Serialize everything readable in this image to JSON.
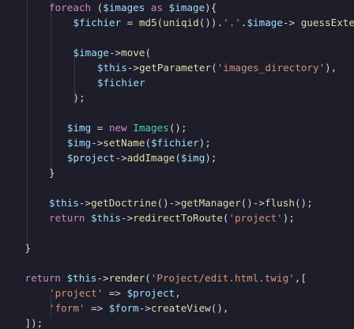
{
  "editor": {
    "language": "php",
    "colors": {
      "background": "#1e1e2a",
      "keyword": "#c586c0",
      "variable": "#9cdcfe",
      "function": "#dcdcaa",
      "string": "#ce9178",
      "class": "#4ec9b0",
      "plain": "#d4d4d4"
    },
    "lines": [
      {
        "indent": 2,
        "tokens": [
          [
            "foreach",
            "kw"
          ],
          [
            " (",
            "pn"
          ],
          [
            "$images",
            "var"
          ],
          [
            " as ",
            "kw"
          ],
          [
            "$image",
            "var"
          ],
          [
            "){",
            "pn"
          ]
        ]
      },
      {
        "indent": 3,
        "tokens": [
          [
            "$fichier",
            "var"
          ],
          [
            " = ",
            "op"
          ],
          [
            "md5",
            "fn"
          ],
          [
            "(",
            "pn"
          ],
          [
            "uniqid",
            "fn"
          ],
          [
            "()).",
            "pn"
          ],
          [
            "'.'",
            "str"
          ],
          [
            ".",
            "op"
          ],
          [
            "$image",
            "var"
          ],
          [
            "-> ",
            "op"
          ],
          [
            "guessExtension",
            "fn"
          ],
          [
            "();",
            "pn"
          ]
        ]
      },
      {
        "indent": 0,
        "tokens": []
      },
      {
        "indent": 3,
        "tokens": [
          [
            "$image",
            "var"
          ],
          [
            "->",
            "op"
          ],
          [
            "move",
            "fn"
          ],
          [
            "(",
            "pn"
          ]
        ]
      },
      {
        "indent": 4,
        "tokens": [
          [
            "$this",
            "var"
          ],
          [
            "->",
            "op"
          ],
          [
            "getParameter",
            "fn"
          ],
          [
            "(",
            "pn"
          ],
          [
            "'images_directory'",
            "str"
          ],
          [
            "),",
            "pn"
          ]
        ]
      },
      {
        "indent": 4,
        "tokens": [
          [
            "$fichier",
            "var"
          ]
        ]
      },
      {
        "indent": 3,
        "tokens": [
          [
            ");",
            "pn"
          ]
        ]
      },
      {
        "indent": 0,
        "tokens": []
      },
      {
        "indent": 2.75,
        "tokens": [
          [
            "$img",
            "var"
          ],
          [
            " = ",
            "op"
          ],
          [
            "new ",
            "kw"
          ],
          [
            "Images",
            "cls"
          ],
          [
            "();",
            "pn"
          ]
        ]
      },
      {
        "indent": 2.75,
        "tokens": [
          [
            "$img",
            "var"
          ],
          [
            "->",
            "op"
          ],
          [
            "setName",
            "fn"
          ],
          [
            "(",
            "pn"
          ],
          [
            "$fichier",
            "var"
          ],
          [
            ");",
            "pn"
          ]
        ]
      },
      {
        "indent": 2.75,
        "tokens": [
          [
            "$project",
            "var"
          ],
          [
            "->",
            "op"
          ],
          [
            "addImage",
            "fn"
          ],
          [
            "(",
            "pn"
          ],
          [
            "$img",
            "var"
          ],
          [
            ");",
            "pn"
          ]
        ]
      },
      {
        "indent": 2,
        "tokens": [
          [
            "}",
            "pn"
          ]
        ]
      },
      {
        "indent": 0,
        "tokens": []
      },
      {
        "indent": 2,
        "tokens": [
          [
            "$this",
            "var"
          ],
          [
            "->",
            "op"
          ],
          [
            "getDoctrine",
            "fn"
          ],
          [
            "()->",
            "pn"
          ],
          [
            "getManager",
            "fn"
          ],
          [
            "()->",
            "pn"
          ],
          [
            "flush",
            "fn"
          ],
          [
            "();",
            "pn"
          ]
        ]
      },
      {
        "indent": 2,
        "tokens": [
          [
            "return ",
            "kw"
          ],
          [
            "$this",
            "var"
          ],
          [
            "->",
            "op"
          ],
          [
            "redirectToRoute",
            "fn"
          ],
          [
            "(",
            "pn"
          ],
          [
            "'project'",
            "str"
          ],
          [
            ");",
            "pn"
          ]
        ]
      },
      {
        "indent": 0,
        "tokens": []
      },
      {
        "indent": 1,
        "tokens": [
          [
            "}",
            "pn"
          ]
        ]
      },
      {
        "indent": 0,
        "tokens": []
      },
      {
        "indent": 1,
        "tokens": [
          [
            "return ",
            "kw"
          ],
          [
            "$this",
            "var"
          ],
          [
            "->",
            "op"
          ],
          [
            "render",
            "fn"
          ],
          [
            "(",
            "pn"
          ],
          [
            "'Project/edit.html.twig'",
            "str"
          ],
          [
            ",[",
            "pn"
          ]
        ]
      },
      {
        "indent": 2,
        "tokens": [
          [
            "'project'",
            "str"
          ],
          [
            " => ",
            "op"
          ],
          [
            "$project",
            "var"
          ],
          [
            ",",
            "pn"
          ]
        ]
      },
      {
        "indent": 2,
        "tokens": [
          [
            "'form'",
            "str"
          ],
          [
            " => ",
            "op"
          ],
          [
            "$form",
            "var"
          ],
          [
            "->",
            "op"
          ],
          [
            "createView",
            "fn"
          ],
          [
            "(),",
            "pn"
          ]
        ]
      },
      {
        "indent": 1,
        "tokens": [
          [
            "]);",
            "pn"
          ]
        ]
      }
    ]
  }
}
